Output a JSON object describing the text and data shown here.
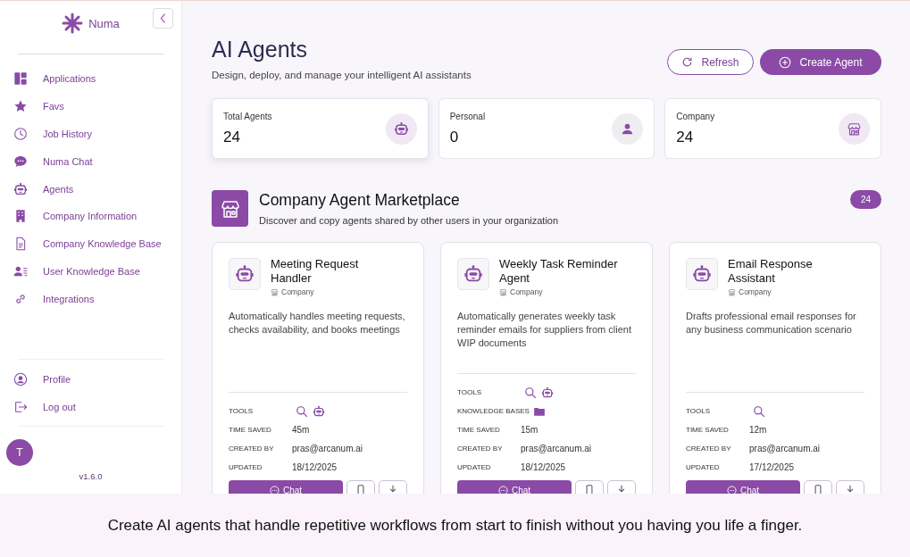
{
  "sidebar": {
    "logo": "Numa",
    "items": [
      {
        "label": "Applications",
        "kind": "grid"
      },
      {
        "label": "Favs",
        "kind": "star"
      },
      {
        "label": "Job History",
        "kind": "clock"
      },
      {
        "label": "Numa Chat",
        "kind": "chat"
      },
      {
        "label": "Agents",
        "kind": "robot"
      },
      {
        "label": "Company Information",
        "kind": "building"
      },
      {
        "label": "Company Knowledge Base",
        "kind": "document"
      },
      {
        "label": "User Knowledge Base",
        "kind": "user-list"
      },
      {
        "label": "Integrations",
        "kind": "link"
      }
    ],
    "bottom_items": [
      {
        "label": "Profile",
        "kind": "profile"
      },
      {
        "label": "Log out",
        "kind": "logout"
      }
    ],
    "avatar": "T",
    "version": "v1.6.0"
  },
  "header": {
    "title": "AI Agents",
    "subtitle": "Design, deploy, and manage your intelligent AI assistants",
    "buttons": [
      {
        "label": "Refresh",
        "kind": "outline"
      },
      {
        "label": "Create Agent",
        "kind": "primary"
      }
    ]
  },
  "stats": [
    {
      "label": "Total Agents",
      "value": "24",
      "kind": "robot"
    },
    {
      "label": "Personal",
      "value": "0",
      "kind": "person"
    },
    {
      "label": "Company",
      "value": "24",
      "kind": "store"
    }
  ],
  "marketplace": {
    "title": "Company Agent Marketplace",
    "subtitle": "Discover and copy agents shared by other users in your organization",
    "count": "24",
    "agents": [
      {
        "name": "Meeting Request Handler",
        "scope": "Company",
        "description": "Automatically handles meeting requests, checks availability, and books meetings",
        "details": [
          {
            "label": "TOOLS",
            "icons": [
              {
                "kind": "search"
              },
              {
                "kind": "robot"
              }
            ]
          },
          {
            "label": "TIME SAVED",
            "value": "45m"
          },
          {
            "label": "CREATED BY",
            "value": "pras@arcanum.ai"
          },
          {
            "label": "UPDATED",
            "value": "18/12/2025"
          }
        ],
        "action": "Chat"
      },
      {
        "name": "Weekly Task Reminder Agent",
        "scope": "Company",
        "description": "Automatically generates weekly task reminder emails for suppliers from client WIP documents",
        "details": [
          {
            "label": "TOOLS",
            "icons": [
              {
                "kind": "search"
              },
              {
                "kind": "robot"
              }
            ]
          },
          {
            "label": "KNOWLEDGE BASES",
            "icons": [
              {
                "kind": "folder"
              }
            ]
          },
          {
            "label": "TIME SAVED",
            "value": "15m"
          },
          {
            "label": "CREATED BY",
            "value": "pras@arcanum.ai"
          },
          {
            "label": "UPDATED",
            "value": "18/12/2025"
          }
        ],
        "action": "Chat"
      },
      {
        "name": "Email Response Assistant",
        "scope": "Company",
        "description": "Drafts professional email responses for any business communication scenario",
        "details": [
          {
            "label": "TOOLS",
            "icons": [
              {
                "kind": "search"
              }
            ]
          },
          {
            "label": "TIME SAVED",
            "value": "12m"
          },
          {
            "label": "CREATED BY",
            "value": "pras@arcanum.ai"
          },
          {
            "label": "UPDATED",
            "value": "17/12/2025"
          }
        ],
        "action": "Chat"
      }
    ]
  },
  "banner": "Create AI agents that handle repetitive workflows from start to finish without you having you life a finger."
}
